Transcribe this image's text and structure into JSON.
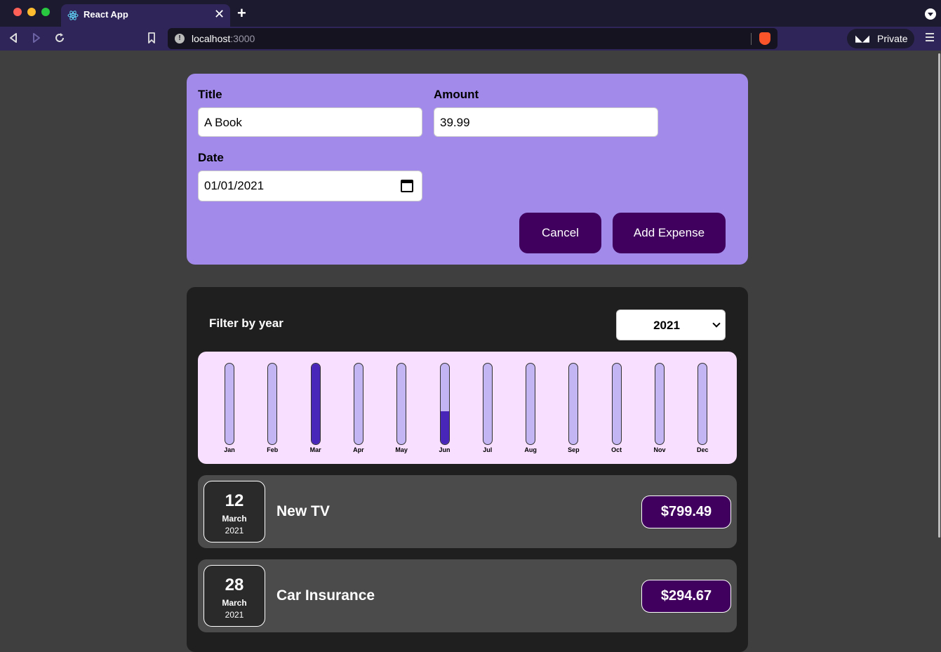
{
  "browser": {
    "tab_title": "React App",
    "url_host": "localhost",
    "url_port": ":3000",
    "private_label": "Private"
  },
  "form": {
    "title_label": "Title",
    "title_value": "A Book",
    "amount_label": "Amount",
    "amount_value": "39.99",
    "date_label": "Date",
    "date_value": "01/01/2021",
    "cancel_label": "Cancel",
    "submit_label": "Add Expense"
  },
  "filter": {
    "label": "Filter by year",
    "selected_year": "2021"
  },
  "chart_data": {
    "type": "bar",
    "categories": [
      "Jan",
      "Feb",
      "Mar",
      "Apr",
      "May",
      "Jun",
      "Jul",
      "Aug",
      "Sep",
      "Oct",
      "Nov",
      "Dec"
    ],
    "fill_fraction": [
      0,
      0,
      1.0,
      0,
      0,
      0.41,
      0,
      0,
      0,
      0,
      0,
      0
    ]
  },
  "expenses": [
    {
      "day": "12",
      "month": "March",
      "year": "2021",
      "title": "New TV",
      "amount": "$799.49"
    },
    {
      "day": "28",
      "month": "March",
      "year": "2021",
      "title": "Car Insurance",
      "amount": "$294.67"
    }
  ],
  "colors": {
    "form_bg": "#a18aea",
    "button_bg": "#40005d",
    "chart_bg": "#f8dfff",
    "bar_track": "#c3b4f3",
    "bar_fill": "#4826b9"
  },
  "icons": [
    "react-icon",
    "close-icon",
    "plus-icon",
    "back-icon",
    "forward-icon",
    "reload-icon",
    "bookmark-icon",
    "info-icon",
    "brave-icon",
    "private-glasses-icon",
    "menu-icon",
    "calendar-icon",
    "chevron-down-icon"
  ]
}
